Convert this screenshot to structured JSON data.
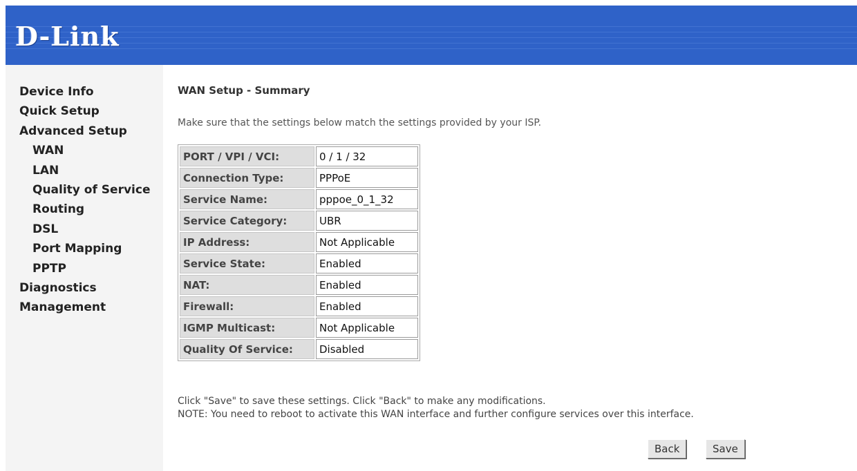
{
  "brand": {
    "logo_text": "D-Link",
    "banner_color": "#2f62c8"
  },
  "sidebar": {
    "items": [
      {
        "label": "Device Info",
        "level": 0
      },
      {
        "label": "Quick Setup",
        "level": 0
      },
      {
        "label": "Advanced Setup",
        "level": 0
      },
      {
        "label": "WAN",
        "level": 1
      },
      {
        "label": "LAN",
        "level": 1
      },
      {
        "label": "Quality of Service",
        "level": 1
      },
      {
        "label": "Routing",
        "level": 1
      },
      {
        "label": "DSL",
        "level": 1
      },
      {
        "label": "Port Mapping",
        "level": 1
      },
      {
        "label": "PPTP",
        "level": 1
      },
      {
        "label": "Diagnostics",
        "level": 0
      },
      {
        "label": "Management",
        "level": 0
      }
    ]
  },
  "main": {
    "title": "WAN Setup - Summary",
    "intro": "Make sure that the settings below match the settings provided by your ISP.",
    "summary": [
      {
        "key": "PORT / VPI / VCI:",
        "value": "0 / 1 / 32"
      },
      {
        "key": "Connection Type:",
        "value": "PPPoE"
      },
      {
        "key": "Service Name:",
        "value": "pppoe_0_1_32"
      },
      {
        "key": "Service Category:",
        "value": "UBR"
      },
      {
        "key": "IP Address:",
        "value": "Not Applicable"
      },
      {
        "key": "Service State:",
        "value": "Enabled"
      },
      {
        "key": "NAT:",
        "value": "Enabled"
      },
      {
        "key": "Firewall:",
        "value": "Enabled"
      },
      {
        "key": "IGMP Multicast:",
        "value": "Not Applicable"
      },
      {
        "key": "Quality Of Service:",
        "value": "Disabled"
      }
    ],
    "note_line1": "Click \"Save\" to save these settings. Click \"Back\" to make any modifications.",
    "note_line2": "NOTE: You need to reboot to activate this WAN interface and further configure services over this interface.",
    "back_label": "Back",
    "save_label": "Save"
  }
}
